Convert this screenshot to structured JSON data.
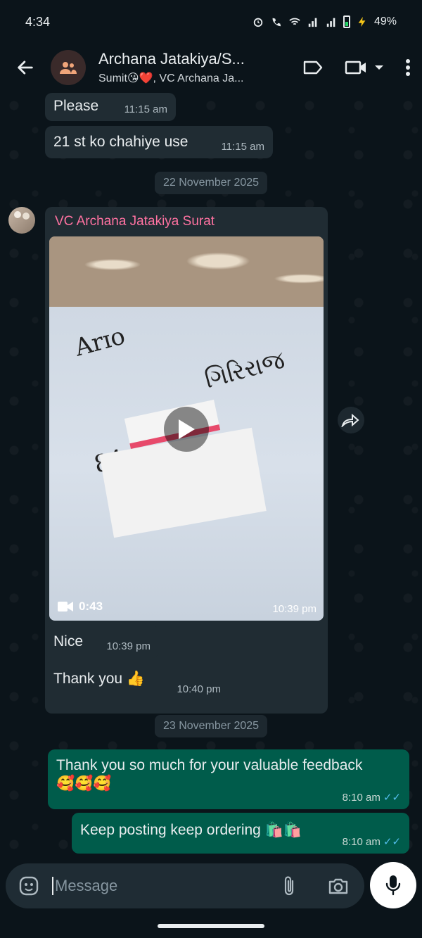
{
  "status_bar": {
    "time": "4:34",
    "battery": "49%"
  },
  "header": {
    "title": "Archana Jatakiya/S...",
    "subtitle": "Sumit😘❤️, VC Archana Ja..."
  },
  "messages": [
    {
      "text": "Please",
      "time": "11:15 am"
    },
    {
      "text": "21 st ko chahiye use",
      "time": "11:15 am"
    }
  ],
  "date_1": "22 November 2025",
  "video_message": {
    "sender": "VC Archana Jatakiya Surat",
    "duration": "0:43",
    "time": "10:39 pm"
  },
  "messages_2": [
    {
      "text": "Nice",
      "time": "10:39 pm"
    },
    {
      "text": "Thank you 👍",
      "time": "10:40 pm"
    }
  ],
  "date_2": "23 November 2025",
  "outgoing": [
    {
      "text": "Thank you so much for your valuable feedback",
      "emoji": "🥰🥰🥰",
      "time": "8:10 am"
    },
    {
      "text": "Keep posting keep ordering 🛍️🛍️",
      "time": "8:10 am"
    }
  ],
  "composer": {
    "placeholder": "Message"
  },
  "colors": {
    "accent": "#005c4b",
    "sender_name": "#ff72a1",
    "ticks": "#53bdeb"
  }
}
